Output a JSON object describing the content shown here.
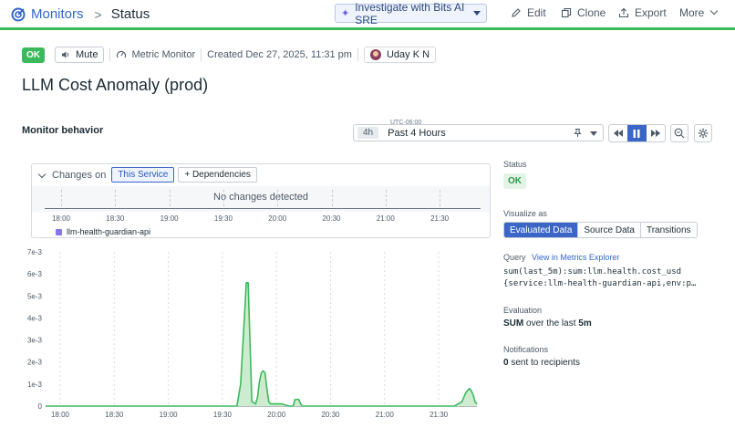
{
  "header": {
    "breadcrumb_root": "Monitors",
    "breadcrumb_sep": ">",
    "breadcrumb_current": "Status",
    "bits_button": "Investigate with Bits AI SRE",
    "actions": {
      "edit": "Edit",
      "clone": "Clone",
      "export": "Export",
      "more": "More"
    }
  },
  "status_row": {
    "status": "OK",
    "mute": "Mute",
    "monitor_type": "Metric Monitor",
    "created": "Created Dec 27, 2025, 11:31 pm",
    "owner": "Uday K N"
  },
  "title": "LLM Cost Anomaly (prod)",
  "behavior": {
    "section_title": "Monitor behavior",
    "timezone": "UTC-06:00",
    "range_chip": "4h",
    "range_label": "Past 4 Hours"
  },
  "changes": {
    "label": "Changes on",
    "this_service": "This Service",
    "dependencies": "+ Dependencies",
    "empty": "No changes detected",
    "legend_series": "llm-health-guardian-api"
  },
  "chart_data": {
    "type": "area",
    "x_ticks": [
      "18:00",
      "18:30",
      "19:00",
      "19:30",
      "20:00",
      "20:30",
      "21:00",
      "21:30"
    ],
    "y_ticks": [
      "0",
      "1e-3",
      "2e-3",
      "3e-3",
      "4e-3",
      "5e-3",
      "6e-3",
      "7e-3"
    ],
    "ylim": [
      0,
      0.007
    ],
    "x_range_min": [
      0,
      230
    ],
    "x": [
      0,
      98,
      100,
      102,
      104,
      106,
      107,
      108,
      110,
      112,
      113,
      114,
      115,
      116,
      117,
      118,
      119,
      120,
      121,
      122,
      124,
      126,
      130,
      132,
      133,
      134,
      135,
      136,
      137,
      138,
      140,
      146,
      218,
      220,
      222,
      223,
      224,
      225,
      226,
      227,
      228,
      229,
      230
    ],
    "values": [
      0,
      0,
      0,
      0,
      0.001,
      0.004,
      0.0056,
      0.0056,
      0.0002,
      0.0001,
      0.0004,
      0.0011,
      0.0015,
      0.0016,
      0.0015,
      0.0008,
      0.0002,
      0.0001,
      0.0001,
      0.0001,
      0.0001,
      0.0001,
      0,
      0,
      0.0003,
      0.0003,
      0.0003,
      0.0001,
      0,
      0,
      0,
      0,
      0,
      0.0001,
      0.0002,
      0.0004,
      0.0006,
      0.0007,
      0.0008,
      0.0007,
      0.0005,
      0.0002,
      0.0001
    ],
    "color": "#3cb95c",
    "fill": "#cdeccf",
    "grid": "dashed vertical"
  },
  "right_panel": {
    "status_label": "Status",
    "status_value": "OK",
    "visualize_label": "Visualize as",
    "visualize_options": [
      "Evaluated Data",
      "Source Data",
      "Transitions"
    ],
    "query_label": "Query",
    "query_link": "View in Metrics Explorer",
    "query_line1": "sum(last_5m):sum:llm.health.cost_usd",
    "query_line2": "{service:llm-health-guardian-api,env:prod}",
    "evaluation_label": "Evaluation",
    "evaluation_agg": "SUM",
    "evaluation_rest": "over the last",
    "evaluation_window": "5m",
    "notifications_label": "Notifications",
    "notifications_count": "0",
    "notifications_rest": "sent to recipients"
  },
  "colors": {
    "accent": "#3b66c7",
    "ok": "#3cb95c",
    "link": "#3366cc"
  }
}
